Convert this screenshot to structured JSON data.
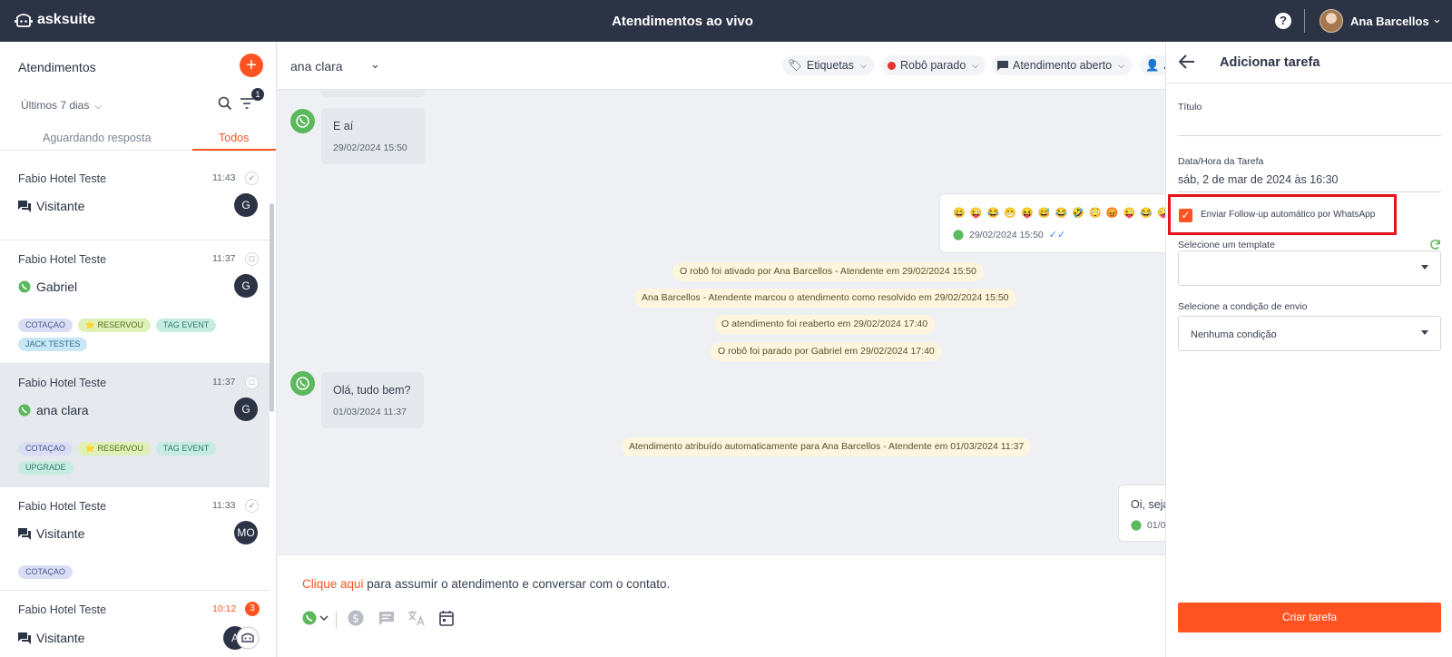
{
  "topbar": {
    "logo": "asksuite",
    "title": "Atendimentos ao vivo",
    "help": "?",
    "user_name": "Ana Barcellos"
  },
  "left": {
    "title": "Atendimentos",
    "period": "Últimos 7 dias",
    "filter_count": "1",
    "tabs": [
      "Aguardando resposta",
      "Todos"
    ],
    "conversations": [
      {
        "name": "Fabio Hotel Teste",
        "time": "11:43",
        "contact": "Visitante",
        "avatar": "G",
        "tags": []
      },
      {
        "name": "Fabio Hotel Teste",
        "time": "11:37",
        "contact": "Gabriel",
        "avatar": "G",
        "tags": [
          "COTAÇAO",
          "⭐ RESERVOU",
          "TAG EVENT",
          "JACK TESTES"
        ]
      },
      {
        "name": "Fabio Hotel Teste",
        "time": "11:37",
        "contact": "ana clara",
        "avatar": "G",
        "tags": [
          "COTAÇAO",
          "⭐ RESERVOU",
          "TAG EVENT",
          "UPGRADE"
        ]
      },
      {
        "name": "Fabio Hotel Teste",
        "time": "11:33",
        "contact": "Visitante",
        "avatar": "MO",
        "tags": [
          "COTAÇAO"
        ]
      },
      {
        "name": "Fabio Hotel Teste",
        "time": "10:12",
        "contact": "Visitante",
        "avatar": "A",
        "unread": "3",
        "tags": []
      }
    ]
  },
  "chat": {
    "contact_name": "ana clara",
    "labels_pill": "Etiquetas",
    "robot_pill": "Robô parado",
    "status_pill": "Atendimento aberto",
    "assign_pill": "A",
    "messages": [
      {
        "text": "E aí",
        "time": "29/02/2024 15:50"
      },
      {
        "text": "Olá, tudo bem?",
        "time": "01/03/2024 11:37"
      }
    ],
    "outgoing": [
      {
        "text": "😄 😜 😂 😁 😝 😅 😂 🤣 😳 😡 😜 😂 🤪",
        "time": "29/02/2024 15:50"
      },
      {
        "text": "Oi, seja",
        "time": "01/0"
      }
    ],
    "system": [
      "O robô foi ativado por Ana Barcellos - Atendente em 29/02/2024 15:50",
      "Ana Barcellos - Atendente marcou o atendimento como resolvido em 29/02/2024 15:50",
      "O atendimento foi reaberto em 29/02/2024 17:40",
      "O robô foi parado por Gabriel em 29/02/2024 17:40",
      "Atendimento atribuído automaticamente para Ana Barcellos - Atendente em 01/03/2024 11:37"
    ],
    "composer_link": "Clique aqui",
    "composer_text": " para assumir o atendimento e conversar com o contato."
  },
  "task_panel": {
    "title": "Adicionar tarefa",
    "title_label": "Título",
    "title_value": "",
    "datetime_label": "Data/Hora da Tarefa",
    "datetime_value": "sáb, 2 de mar de 2024 às 16:30",
    "followup_label": "Enviar Follow-up automático por WhatsApp",
    "followup_checked": true,
    "template_label": "Selecione um template",
    "template_value": "",
    "condition_label": "Selecione a condição de envio",
    "condition_value": "Nenhuma condição",
    "submit": "Criar tarefa"
  },
  "colors": {
    "accent": "#ff5422",
    "topbar": "#2c3345",
    "whatsapp": "#5cb85c",
    "highlight": "#e3141c"
  }
}
